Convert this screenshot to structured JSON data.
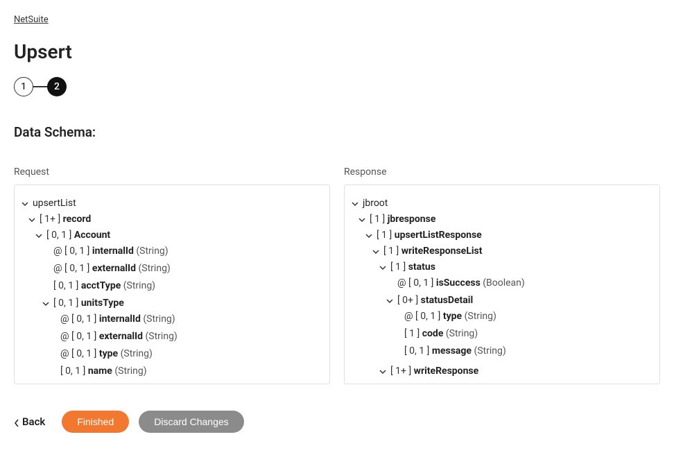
{
  "breadcrumb": "NetSuite",
  "title": "Upsert",
  "steps": {
    "one": "1",
    "two": "2"
  },
  "section_title": "Data Schema:",
  "request_label": "Request",
  "response_label": "Response",
  "footer": {
    "back": "Back",
    "finished": "Finished",
    "discard": "Discard Changes"
  },
  "req": {
    "upsertList": "upsertList",
    "record_card": "[ 1+ ]",
    "record": "record",
    "account_card": "[ 0, 1 ]",
    "account": "Account",
    "acc_internalId_card": "@ [ 0, 1 ]",
    "acc_internalId": "internalId",
    "acc_internalId_type": "(String)",
    "acc_externalId_card": "@ [ 0, 1 ]",
    "acc_externalId": "externalId",
    "acc_externalId_type": "(String)",
    "acctType_card": "[ 0, 1 ]",
    "acctType": "acctType",
    "acctType_type": "(String)",
    "unitsType_card": "[ 0, 1 ]",
    "unitsType": "unitsType",
    "ut_internalId_card": "@ [ 0, 1 ]",
    "ut_internalId": "internalId",
    "ut_internalId_type": "(String)",
    "ut_externalId_card": "@ [ 0, 1 ]",
    "ut_externalId": "externalId",
    "ut_externalId_type": "(String)",
    "ut_type_card": "@ [ 0, 1 ]",
    "ut_type": "type",
    "ut_type_type": "(String)",
    "ut_name_card": "[ 0, 1 ]",
    "ut_name": "name",
    "ut_name_type": "(String)"
  },
  "res": {
    "jbroot": "jbroot",
    "jbresponse_card": "[ 1 ]",
    "jbresponse": "jbresponse",
    "upsertListResponse_card": "[ 1 ]",
    "upsertListResponse": "upsertListResponse",
    "writeResponseList_card": "[ 1 ]",
    "writeResponseList": "writeResponseList",
    "status_card": "[ 1 ]",
    "status": "status",
    "isSuccess_card": "@ [ 0, 1 ]",
    "isSuccess": "isSuccess",
    "isSuccess_type": "(Boolean)",
    "statusDetail_card": "[ 0+ ]",
    "statusDetail": "statusDetail",
    "sd_type_card": "@ [ 0, 1 ]",
    "sd_type": "type",
    "sd_type_type": "(String)",
    "sd_code_card": "[ 1 ]",
    "sd_code": "code",
    "sd_code_type": "(String)",
    "sd_message_card": "[ 0, 1 ]",
    "sd_message": "message",
    "sd_message_type": "(String)",
    "writeResponse_card": "[ 1+ ]",
    "writeResponse": "writeResponse"
  }
}
